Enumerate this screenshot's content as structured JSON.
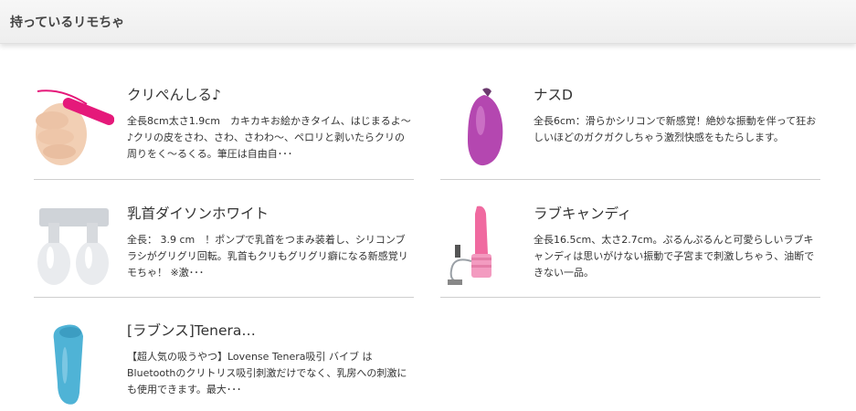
{
  "header": {
    "title": "持っているリモちゃ"
  },
  "items": [
    {
      "title": "クリぺんしる♪",
      "desc": "全長8cm太さ1.9cm　カキカキお絵かきタイム、はじまるよ～♪クリの皮をさわ、さわ、さわわ～、ペロリと剥いたらクリの周りをく～るくる。筆圧は自由自･･･"
    },
    {
      "title": "ナスD",
      "desc": "全長6cm：滑らかシリコンで新感覚！絶妙な振動を伴って狂おしいほどのガクガクしちゃう激烈快感をもたらします。"
    },
    {
      "title": "乳首ダイソンホワイト",
      "desc": "全長： 3.9 cm　！ポンプで乳首をつまみ装着し、シリコンブラシがグリグリ回転。乳首もクリもグリグリ癖になる新感覚リモちゃ！ ※激･･･"
    },
    {
      "title": "ラブキャンディ",
      "desc": "全長16.5cm、太さ2.7cm。ぷるんぷるんと可愛らしいラブキャンディは思いがけない振動で子宮まで刺激しちゃう、油断できない一品。"
    },
    {
      "title": "[ラブンス]Tenera…",
      "desc": "【超人気の吸うやつ】Lovense Tenera吸引 バイブ は Bluetoothのクリトリス吸引刺激だけでなく、乳房への刺激にも使用できます。最大･･･"
    }
  ]
}
